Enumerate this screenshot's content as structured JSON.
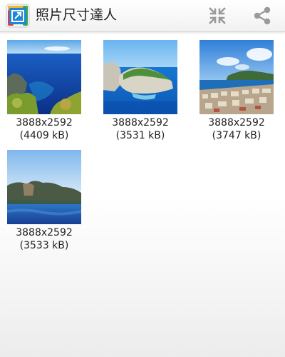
{
  "app": {
    "title": "照片尺寸達人",
    "icon": "app-photo-icon"
  },
  "actions": [
    {
      "name": "shrink-icon",
      "label": "Shrink"
    },
    {
      "name": "share-icon",
      "label": "Share"
    }
  ],
  "photos": [
    {
      "dimensions": "3888x2592",
      "size": "(4409 kB)",
      "scene": "cove-cliffs"
    },
    {
      "dimensions": "3888x2592",
      "size": "(3531 kB)",
      "scene": "shipwreck-beach"
    },
    {
      "dimensions": "3888x2592",
      "size": "(3747 kB)",
      "scene": "harbor-town"
    },
    {
      "dimensions": "3888x2592",
      "size": "(3533 kB)",
      "scene": "island-coast"
    }
  ],
  "colors": {
    "toolbar_icon": "#9a9a9a",
    "text": "#222222"
  }
}
